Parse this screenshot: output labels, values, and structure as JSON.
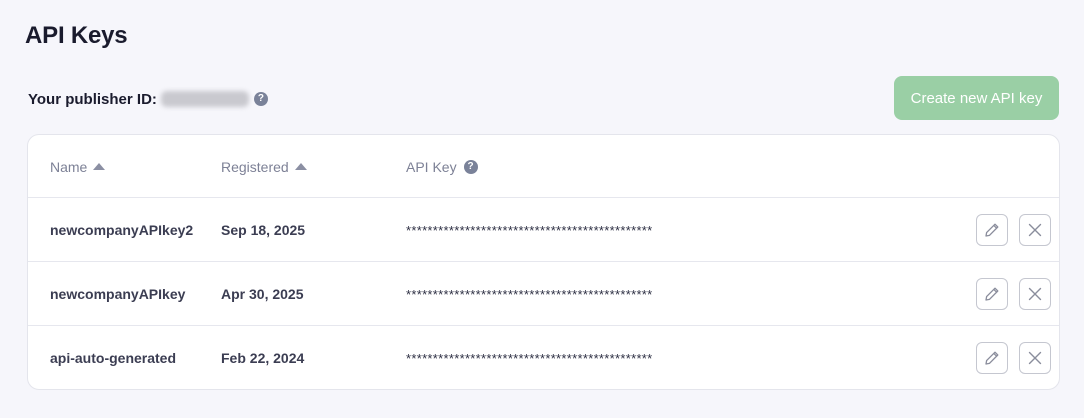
{
  "page": {
    "title": "API Keys",
    "publisher_label": "Your publisher ID:",
    "help_glyph": "?"
  },
  "actions": {
    "create_label": "Create new API key"
  },
  "table": {
    "columns": {
      "name": "Name",
      "registered": "Registered",
      "api_key": "API Key"
    },
    "rows": [
      {
        "name": "newcompanyAPIkey2",
        "registered": "Sep 18, 2025",
        "api_key": "**********************************************"
      },
      {
        "name": "newcompanyAPIkey",
        "registered": "Apr 30, 2025",
        "api_key": "**********************************************"
      },
      {
        "name": "api-auto-generated",
        "registered": "Feb 22, 2024",
        "api_key": "**********************************************"
      }
    ]
  },
  "icons": {
    "help": "help-icon",
    "sort": "sort-ascending-icon",
    "edit": "pencil-icon",
    "delete": "close-icon"
  },
  "colors": {
    "accent_button": "#9acfa5",
    "page_background": "#f6f6fb",
    "help_icon": "#7a8299"
  }
}
